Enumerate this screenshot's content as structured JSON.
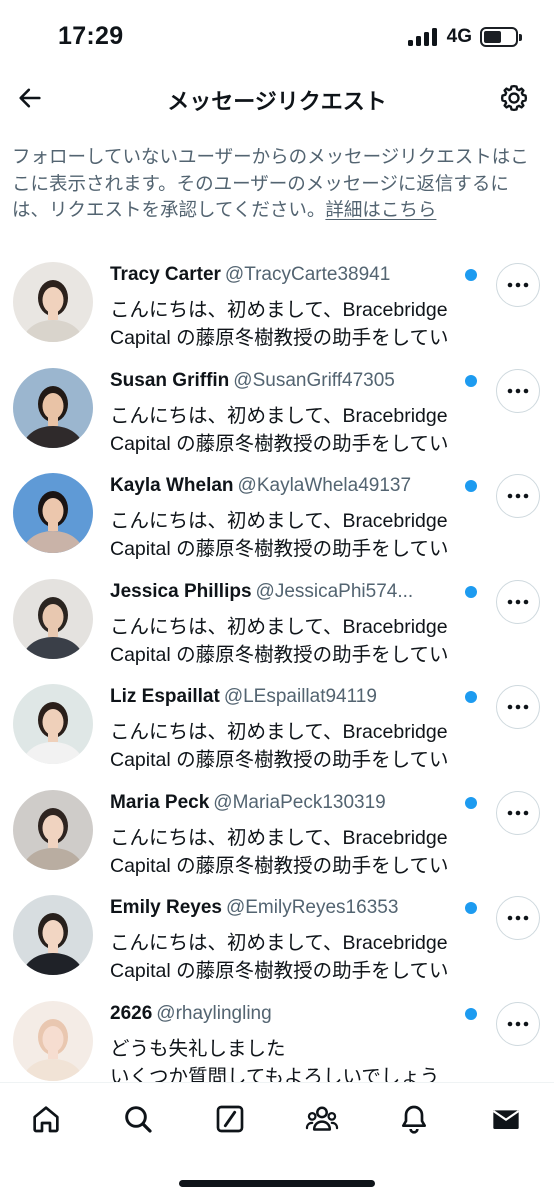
{
  "status_bar": {
    "time": "17:29",
    "network": "4G",
    "battery_level": 0.55,
    "signal_bars": 4
  },
  "header": {
    "title": "メッセージリクエスト",
    "back_icon": "arrow-left-icon",
    "settings_icon": "gear-icon"
  },
  "info": {
    "text": "フォローしていないユーザーからのメッセージリクエストはここに表示されます。そのユーザーのメッセージに返信するには、リクエストを承認してください。",
    "link_text": "詳細はこちら"
  },
  "requests": [
    {
      "name": "Tracy Carter",
      "handle": "@TracyCarte38941",
      "line1": "こんにちは、初めまして、Bracebridge",
      "line2": "Capital の藤原冬樹教授の助手をしてい",
      "unread": true
    },
    {
      "name": "Susan Griffin",
      "handle": "@SusanGriff47305",
      "line1": "こんにちは、初めまして、Bracebridge",
      "line2": "Capital の藤原冬樹教授の助手をしてい",
      "unread": true
    },
    {
      "name": "Kayla Whelan",
      "handle": "@KaylaWhela49137",
      "line1": "こんにちは、初めまして、Bracebridge",
      "line2": "Capital の藤原冬樹教授の助手をしてい",
      "unread": true
    },
    {
      "name": "Jessica Phillips",
      "handle": "@JessicaPhi574...",
      "line1": "こんにちは、初めまして、Bracebridge",
      "line2": "Capital の藤原冬樹教授の助手をしてい",
      "unread": true
    },
    {
      "name": "Liz Espaillat",
      "handle": "@LEspaillat94119",
      "line1": "こんにちは、初めまして、Bracebridge",
      "line2": "Capital の藤原冬樹教授の助手をしてい",
      "unread": true
    },
    {
      "name": "Maria Peck",
      "handle": "@MariaPeck130319",
      "line1": "こんにちは、初めまして、Bracebridge",
      "line2": "Capital の藤原冬樹教授の助手をしてい",
      "unread": true
    },
    {
      "name": "Emily Reyes",
      "handle": "@EmilyReyes16353",
      "line1": "こんにちは、初めまして、Bracebridge",
      "line2": "Capital の藤原冬樹教授の助手をしてい",
      "unread": true
    },
    {
      "name": "2626",
      "handle": "@rhaylingling",
      "line1": "どうも失礼しました",
      "line2": "いくつか質問してもよろしいでしょう",
      "unread": true
    }
  ],
  "bottom_nav": [
    {
      "icon": "home-icon"
    },
    {
      "icon": "search-icon"
    },
    {
      "icon": "grok-icon"
    },
    {
      "icon": "communities-icon"
    },
    {
      "icon": "bell-icon"
    },
    {
      "icon": "mail-icon",
      "active": true
    }
  ],
  "colors": {
    "accent": "#1d9bf0",
    "text": "#0f1419",
    "muted": "#536471",
    "border": "#cfd9de"
  }
}
